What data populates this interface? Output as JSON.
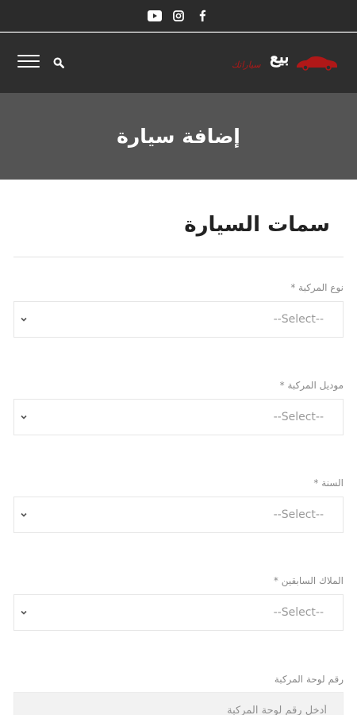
{
  "social": {
    "icons": [
      "youtube-icon",
      "instagram-icon",
      "facebook-icon"
    ]
  },
  "header": {
    "logo_main": "بيع",
    "logo_sub": "سياراتك",
    "menu_icon": "hamburger-menu-icon",
    "search_icon": "search-icon"
  },
  "banner": {
    "title": "إضافة سيارة"
  },
  "section": {
    "title": "سمات السيارة"
  },
  "fields": [
    {
      "label": "نوع المركبة *",
      "value": "--Select--"
    },
    {
      "label": "موديل المركبة *",
      "value": "--Select--"
    },
    {
      "label": "السنة *",
      "value": "--Select--"
    },
    {
      "label": "الملاك السابقين *",
      "value": "--Select--"
    }
  ],
  "plate_field": {
    "label": "رقم لوحة المركبة",
    "placeholder": "أدخل رقم لوحة المركبة"
  },
  "colors": {
    "topbar": "#2b2b2b",
    "header": "#2e2e2e",
    "banner": "#545454",
    "logo_accent": "#b01818"
  }
}
